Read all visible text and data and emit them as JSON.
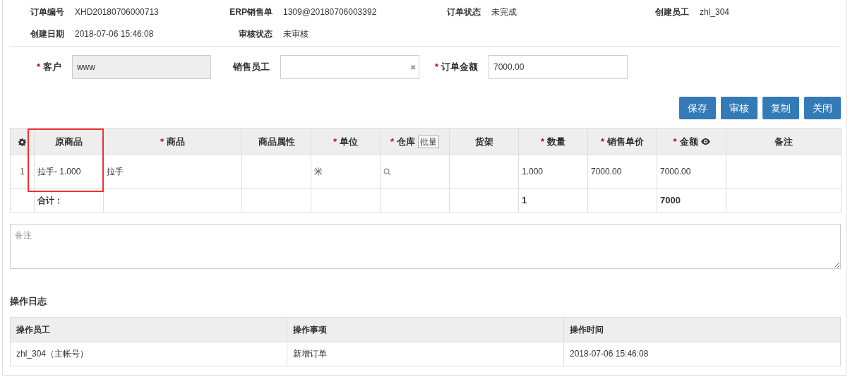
{
  "info": [
    {
      "label": "订单编号",
      "value": "XHD20180706000713"
    },
    {
      "label": "ERP销售单",
      "value": "1309@20180706003392"
    },
    {
      "label": "订单状态",
      "value": "未完成"
    },
    {
      "label": "创建员工",
      "value": "zhl_304"
    },
    {
      "label": "创建日期",
      "value": "2018-07-06 15:46:08"
    },
    {
      "label": "审核状态",
      "value": "未审核"
    }
  ],
  "form": [
    {
      "label": "客户",
      "mark": "*",
      "value": "www",
      "disabled": true
    },
    {
      "label": "销售员工",
      "disabled": false,
      "clear_icon": "✖"
    },
    {
      "label": "订单金额",
      "mark": "*",
      "value": "7000.00",
      "disabled": false
    }
  ],
  "buttons": [
    "保存",
    "审核",
    "复制",
    "关闭"
  ],
  "table": {
    "columns": [
      {
        "kind": "settings"
      },
      {
        "label": "原商品"
      },
      {
        "label": "商品",
        "mark": "*"
      },
      {
        "label": "商品属性"
      },
      {
        "label": "单位",
        "mark": "*"
      },
      {
        "label": "仓库",
        "mark": "*",
        "action": "批量"
      },
      {
        "label": "货架"
      },
      {
        "label": "数量",
        "mark": "*"
      },
      {
        "label": "销售单价",
        "mark": "*"
      },
      {
        "label": "金额",
        "mark": "*",
        "eye": true
      },
      {
        "label": "备注"
      }
    ],
    "rows": [
      {
        "cells": [
          "1",
          "拉手- 1.000",
          "拉手",
          "",
          "米",
          {
            "kind": "lookup"
          },
          "",
          "1.000",
          "7000.00",
          "7000.00",
          ""
        ]
      }
    ],
    "total": {
      "label": "合计：",
      "cells": [
        "",
        "",
        "",
        "",
        "",
        "",
        "",
        "1",
        "",
        "7000",
        ""
      ]
    }
  },
  "remarks": {
    "placeholder": "备注"
  },
  "log": {
    "title": "操作日志",
    "columns": [
      "操作员工",
      "操作事项",
      "操作时间"
    ],
    "rows": [
      [
        "zhl_304（主帐号）",
        "新增订单",
        "2018-07-06 15:46:08"
      ]
    ]
  }
}
